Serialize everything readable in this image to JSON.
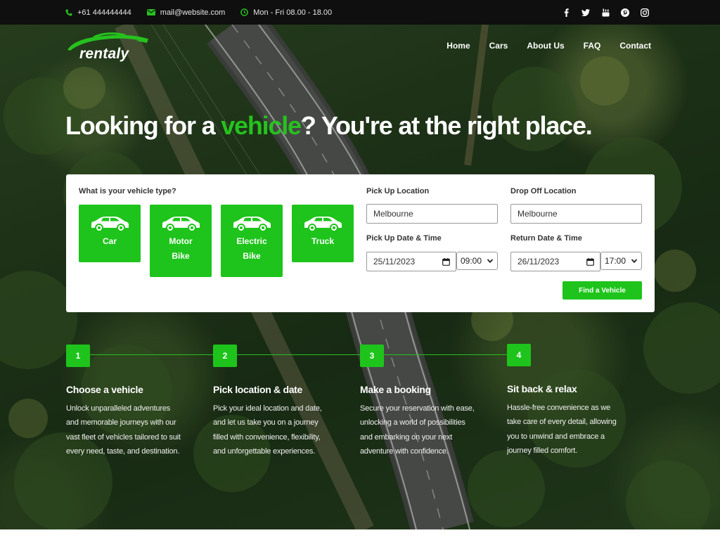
{
  "topbar": {
    "phone": "+61 444444444",
    "email": "mail@website.com",
    "hours": "Mon - Fri 08.00 - 18.00",
    "social": [
      "facebook-icon",
      "twitter-icon",
      "youtube-icon",
      "pinterest-icon",
      "instagram-icon"
    ]
  },
  "brand": {
    "name": "rentaly"
  },
  "nav": {
    "items": [
      "Home",
      "Cars",
      "About Us",
      "FAQ",
      "Contact"
    ]
  },
  "hero": {
    "headline_before": "Looking for a ",
    "headline_accent": "vehicle",
    "headline_after": "? You're at the right place."
  },
  "booking": {
    "vehicle_type_label": "What is your vehicle type?",
    "vehicle_types": [
      {
        "line1": "Car",
        "line2": ""
      },
      {
        "line1": "Motor",
        "line2": "Bike"
      },
      {
        "line1": "Electric",
        "line2": "Bike"
      },
      {
        "line1": "Truck",
        "line2": ""
      }
    ],
    "pickup_location_label": "Pick Up Location",
    "pickup_location_value": "Melbourne",
    "dropoff_location_label": "Drop Off Location",
    "dropoff_location_value": "Melbourne",
    "pickup_datetime_label": "Pick Up Date & Time",
    "pickup_date": "25/11/2023",
    "pickup_time": "09:00",
    "return_datetime_label": "Return Date & Time",
    "return_date": "26/11/2023",
    "return_time": "17:00",
    "submit_label": "Find a Vehicle"
  },
  "steps": [
    {
      "num": "1",
      "title": "Choose a vehicle",
      "desc": "Unlock unparalleled adventures and memorable journeys with our vast fleet of vehicles tailored to suit every need, taste, and destination."
    },
    {
      "num": "2",
      "title": "Pick location & date",
      "desc": "Pick your ideal location and date, and let us take you on a journey filled with convenience, flexibility, and unforgettable experiences."
    },
    {
      "num": "3",
      "title": "Make a booking",
      "desc": "Secure your reservation with ease, unlocking a world of possibilities and embarking on your next adventure with confidence."
    },
    {
      "num": "4",
      "title": "Sit back & relax",
      "desc": "Hassle-free convenience as we take care of every detail, allowing you to unwind and embrace a journey filled comfort."
    }
  ],
  "colors": {
    "accent": "#1ec41b",
    "topbar_bg": "#0f0f0f",
    "card_bg": "#ffffff"
  }
}
